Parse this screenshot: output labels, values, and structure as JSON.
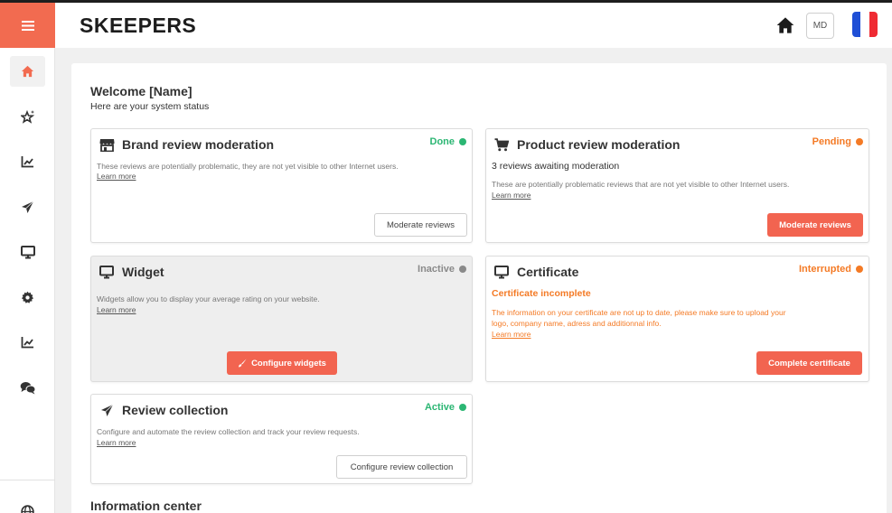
{
  "brand": {
    "logo": "SKEEPERS",
    "accent": "#f26b50"
  },
  "topbar": {
    "avatar_initials": "MD",
    "home_icon": "home-icon",
    "flag": "france-flag"
  },
  "sidebar": {
    "menu_icon": "hamburger-icon",
    "items": [
      {
        "icon": "home-icon",
        "active": true
      },
      {
        "icon": "star-sparkle-icon"
      },
      {
        "icon": "chart-line-icon"
      },
      {
        "icon": "paper-plane-icon"
      },
      {
        "icon": "monitor-icon"
      },
      {
        "icon": "gear-icon"
      },
      {
        "icon": "chart-line-icon"
      },
      {
        "icon": "chat-bubbles-icon"
      },
      {
        "icon": "globe-icon"
      }
    ]
  },
  "welcome": {
    "title": "Welcome [Name]",
    "subtitle": "Here are your system status"
  },
  "cards": {
    "brand": {
      "title": "Brand review moderation",
      "status": "Done",
      "status_color": "#2bb673",
      "text": "These reviews are potentially problematic, they are not yet visible to other Internet users.",
      "link": "Learn more",
      "button": "Moderate reviews"
    },
    "product": {
      "title": "Product review moderation",
      "status": "Pending",
      "status_color": "#f47a25",
      "subtitle": "3 reviews awaiting moderation",
      "text": "These are potentially problematic reviews that are not yet visible to other Internet users.",
      "link": "Learn more",
      "button": "Moderate reviews"
    },
    "widget": {
      "title": "Widget",
      "status": "Inactive",
      "status_color": "#8a8a8a",
      "text": "Widgets allow you to display your average rating on your website.",
      "link": "Learn more",
      "button": "Configure widgets"
    },
    "certificate": {
      "title": "Certificate",
      "status": "Interrupted",
      "status_color": "#f47a25",
      "subtitle": "Certificate incomplete",
      "text_line1": "The information on your certificate are not up to date, please make sure to upload your",
      "text_line2": "logo, company name, adress and additionnal info.",
      "link": "Learn more",
      "button": "Complete certificate"
    },
    "collection": {
      "title": "Review collection",
      "status": "Active",
      "status_color": "#2bb673",
      "text": "Configure and automate the review collection and track your review requests.",
      "link": "Learn more",
      "button": "Configure review collection"
    }
  },
  "info_center": {
    "title": "Information center"
  }
}
